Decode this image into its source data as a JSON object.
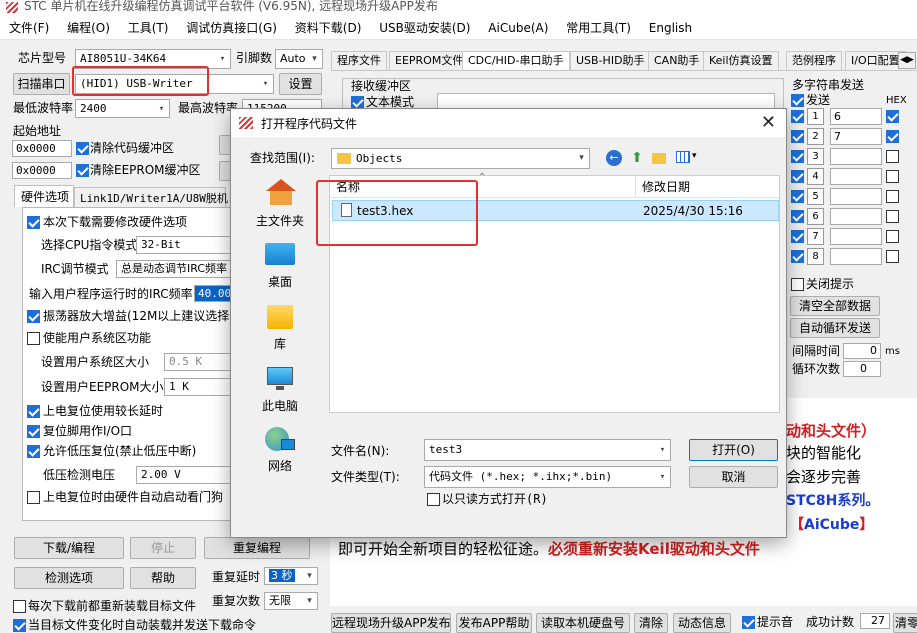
{
  "window": {
    "title": "STC 单片机在线升级编程仿真调试平台软件 (V6.95N), 远程现场升级APP发布"
  },
  "menu": [
    "文件(F)",
    "编程(O)",
    "工具(T)",
    "调试仿真接口(G)",
    "资料下载(D)",
    "USB驱动安装(D)",
    "AiCube(A)",
    "常用工具(T)",
    "English"
  ],
  "left": {
    "chip_label": "芯片型号",
    "chip_value": "AI8051U-34K64",
    "pins_label": "引脚数",
    "pins_value": "Auto",
    "scan_button": "扫描串口",
    "port_value": "(HID1) USB-Writer",
    "settings_button": "设置",
    "min_baud_label": "最低波特率",
    "min_baud_value": "2400",
    "max_baud_label": "最高波特率",
    "max_baud_value": "115200",
    "start_addr_label": "起始地址",
    "addr1": "0x0000",
    "clear_code": "清除代码缓冲区",
    "addr2": "0x0000",
    "clear_eeprom": "清除EEPROM缓冲区",
    "hw_tab": "硬件选项",
    "link_tab": "Link1D/Writer1A/U8W脱机",
    "opts": {
      "modify_hw": "本次下载需要修改硬件选项",
      "cpu_mode_label": "选择CPU指令模式",
      "cpu_mode_value": "32-Bit",
      "irc_mode_label": "IRC调节模式",
      "irc_mode_value": "总是动态调节IRC频率",
      "irc_freq_label": "输入用户程序运行时的IRC频率",
      "irc_freq_value": "40.000",
      "amp": "振荡器放大增益(12M以上建议选择)",
      "user_sys": "使能用户系统区功能",
      "sys_size_label": "设置用户系统区大小",
      "sys_size_value": "0.5 K",
      "eeprom_size_label": "设置用户EEPROM大小",
      "eeprom_size_value": "1  K",
      "long_delay": "上电复位使用较长延时",
      "reset_pin": "复位脚用作I/O口",
      "lvr": "允许低压复位(禁止低压中断)",
      "lvd_label": "低压检测电压",
      "lvd_value": "2.00 V",
      "auto_boot": "上电复位时由硬件自动启动看门狗"
    },
    "download_button": "下载/编程",
    "stop_button": "停止",
    "reprogram_button": "重复编程",
    "detect_button": "检测选项",
    "help_button": "帮助",
    "repeat_delay_label": "重复延时",
    "repeat_delay_value": "3 秒",
    "repeat_count_label": "重复次数",
    "repeat_count_value": "无限",
    "reload_each": "每次下载前都重新装载目标文件",
    "auto_send": "当目标文件变化时自动装载并发送下载命令"
  },
  "right_tabs": [
    "程序文件",
    "EEPROM文件",
    "CDC/HID-串口助手",
    "USB-HID助手",
    "CAN助手",
    "Keil仿真设置",
    "范例程序",
    "I/O口配置"
  ],
  "recv": {
    "title": "接收缓冲区",
    "text_mode": "文本模式"
  },
  "multi": {
    "title": "多字符串发送",
    "send_header": "发送",
    "hex_header": "HEX",
    "rows": [
      {
        "n": "1",
        "v": "6"
      },
      {
        "n": "2",
        "v": "7"
      },
      {
        "n": "3",
        "v": ""
      },
      {
        "n": "4",
        "v": ""
      },
      {
        "n": "5",
        "v": ""
      },
      {
        "n": "6",
        "v": ""
      },
      {
        "n": "7",
        "v": ""
      },
      {
        "n": "8",
        "v": ""
      }
    ],
    "close_tip": "关闭提示",
    "clear_all": "清空全部数据",
    "auto_loop": "自动循环发送",
    "interval_label": "间隔时间",
    "interval_value": "0",
    "interval_unit": "ms",
    "loop_label": "循环次数",
    "loop_value": "0"
  },
  "info": {
    "line1": "动和头文件）",
    "line2": "块的智能化",
    "line3": "会逐步完善",
    "line4": "STC8H系列。",
    "line5_pre": "【",
    "line5_brand": "AiCube",
    "line5_post": "】",
    "line6_a": "即可开始全新项目的轻松征途。",
    "line6_b": "必须重新安装Keil驱动和头文件"
  },
  "bottom": {
    "b1": "远程现场升级APP发布",
    "b2": "发布APP帮助",
    "b3": "读取本机硬盘号",
    "b4": "清除",
    "b5": "动态信息",
    "tip_sound": "提示音",
    "success_label": "成功计数",
    "success_value": "27",
    "clear": "清零"
  },
  "dialog": {
    "title": "打开程序代码文件",
    "lookin_label": "查找范围(I):",
    "lookin_value": "Objects",
    "places": [
      "主文件夹",
      "桌面",
      "库",
      "此电脑",
      "网络"
    ],
    "col_name": "名称",
    "col_date": "修改日期",
    "files": [
      {
        "name": "test3.hex",
        "date": "2025/4/30 15:16"
      }
    ],
    "filename_label": "文件名(N):",
    "filename_value": "test3",
    "filetype_label": "文件类型(T):",
    "filetype_value": "代码文件 (*.hex;  *.ihx;*.bin)",
    "readonly": "以只读方式打开(R)",
    "open_button": "打开(O)",
    "cancel_button": "取消"
  }
}
